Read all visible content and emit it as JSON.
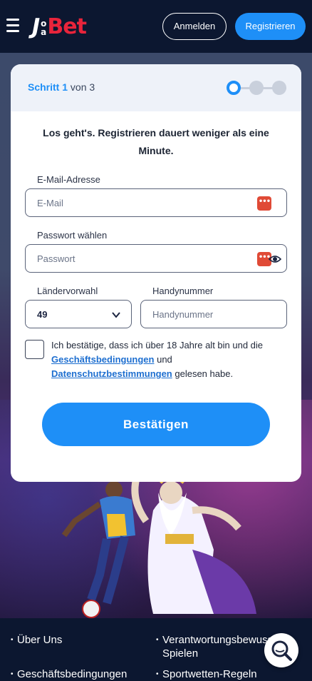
{
  "header": {
    "logo_text": "JoaBet",
    "login_label": "Anmelden",
    "register_label": "Registrieren"
  },
  "steps": {
    "step_word": "Schritt",
    "current": "1",
    "of_text": "von 3",
    "total": 3
  },
  "form": {
    "intro": "Los geht's. Registrieren dauert weniger als eine Minute.",
    "email_label": "E-Mail-Adresse",
    "email_placeholder": "E-Mail",
    "password_label": "Passwort wählen",
    "password_placeholder": "Passwort",
    "country_label": "Ländervorwahl",
    "country_value": "49",
    "phone_label": "Handynummer",
    "phone_placeholder": "Handynummer",
    "terms_prefix": "Ich bestätige, dass ich über 18 Jahre alt bin und die",
    "terms_link1": "Geschäftsbedingungen",
    "terms_middle": "und",
    "terms_link2": "Datenschutzbestimmungen",
    "terms_suffix": "gelesen habe.",
    "confirm_label": "Bestätigen"
  },
  "footer": {
    "links": [
      "Über Uns",
      "Verantwortungsbewusstes",
      "Spielen",
      "Geschäftsbedingungen",
      "Sportwetten-Regeln"
    ]
  },
  "icons": {
    "menu": "hamburger-icon",
    "password_manager": "password-dots-icon",
    "show_password": "eye-icon",
    "dropdown": "chevron-down-icon",
    "chat": "search-chat-icon"
  },
  "colors": {
    "accent": "#1e8ff7",
    "brand_red": "#e8243b",
    "header_bg": "#0c1730"
  }
}
